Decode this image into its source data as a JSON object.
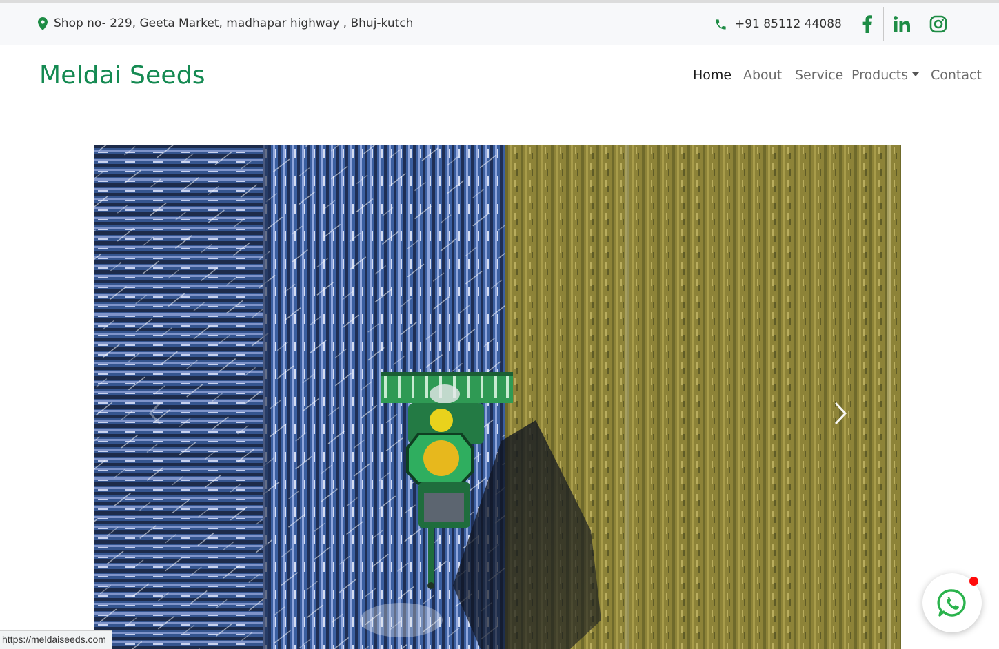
{
  "topbar": {
    "address": "Shop no- 229, Geeta Market, madhapar highway , Bhuj-kutch",
    "phone": "+91 85112 44088",
    "social": [
      "facebook-icon",
      "linkedin-icon",
      "instagram-icon"
    ]
  },
  "navbar": {
    "brand": "Meldai Seeds",
    "items": [
      {
        "label": "Home",
        "active": true
      },
      {
        "label": "About"
      },
      {
        "label": "Service"
      },
      {
        "label": "Products",
        "dropdown": true
      },
      {
        "label": "Contact"
      }
    ]
  },
  "carousel": {
    "prev_icon": "chevron-left-icon",
    "next_icon": "chevron-right-icon"
  },
  "status_url": "https://meldaiseeds.com",
  "whatsapp": {
    "icon": "whatsapp-icon",
    "has_notification": true
  },
  "colors": {
    "brand_green": "#158a52",
    "icon_green": "#1e8c45",
    "notification_red": "#ff0a0a"
  }
}
